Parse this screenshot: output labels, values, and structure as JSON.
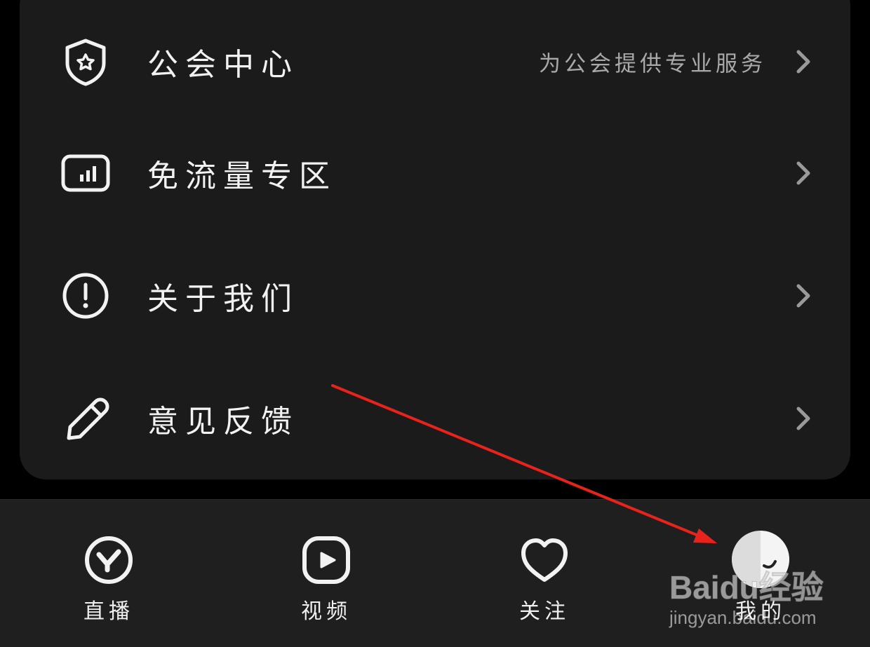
{
  "menu": {
    "items": [
      {
        "label": "公会中心",
        "subtitle": "为公会提供专业服务",
        "icon": "shield-star-icon"
      },
      {
        "label": "免流量专区",
        "subtitle": "",
        "icon": "signal-bars-icon"
      },
      {
        "label": "关于我们",
        "subtitle": "",
        "icon": "info-exclamation-icon"
      },
      {
        "label": "意见反馈",
        "subtitle": "",
        "icon": "pencil-icon"
      }
    ]
  },
  "tabbar": {
    "tabs": [
      {
        "label": "直播",
        "icon": "live-y-icon"
      },
      {
        "label": "视频",
        "icon": "video-play-icon"
      },
      {
        "label": "关注",
        "icon": "heart-icon"
      },
      {
        "label": "我的",
        "icon": "avatar-icon"
      }
    ]
  },
  "watermark": {
    "brand": "Baidu经验",
    "url": "jingyan.baidu.com"
  },
  "colors": {
    "background": "#000000",
    "card": "#1b1b1b",
    "tabbar": "#1f1f1f",
    "text": "#f2f2f2",
    "subtext": "#a9a9a9",
    "annotation_arrow": "#e8231b"
  }
}
